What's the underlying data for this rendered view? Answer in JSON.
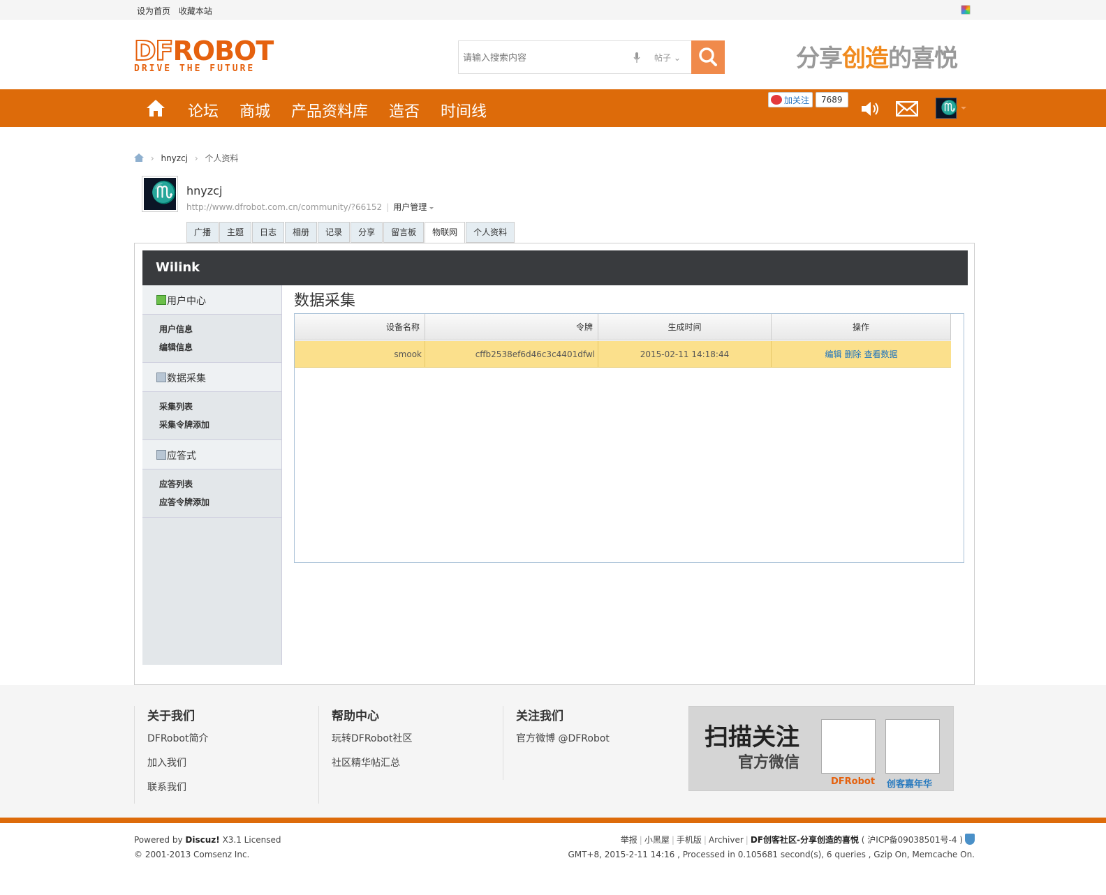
{
  "topbar": {
    "set_home": "设为首页",
    "bookmark": "收藏本站"
  },
  "header": {
    "logo_main_df": "DF",
    "logo_main_robot": "ROBOT",
    "logo_sub": "DRIVE THE FUTURE",
    "search_placeholder": "请输入搜索内容",
    "search_type": "帖子",
    "slogan_a": "分享",
    "slogan_b": "创造",
    "slogan_c": "的喜悦"
  },
  "nav": {
    "items": [
      "论坛",
      "商城",
      "产品资料库",
      "造否",
      "时间线"
    ],
    "weibo_follow": "加关注",
    "weibo_count": "7689"
  },
  "breadcrumb": {
    "user": "hnyzcj",
    "page": "个人资料"
  },
  "profile": {
    "username": "hnyzcj",
    "url": "http://www.dfrobot.com.cn/community/?66152",
    "manage": "用户管理"
  },
  "tabs": [
    "广播",
    "主题",
    "日志",
    "相册",
    "记录",
    "分享",
    "留言板",
    "物联网",
    "个人资料"
  ],
  "active_tab": "物联网",
  "wilink": {
    "title": "Wilink",
    "sections": [
      {
        "title": "用户中心",
        "items": [
          "用户信息",
          "编辑信息"
        ]
      },
      {
        "title": "数据采集",
        "items": [
          "采集列表",
          "采集令牌添加"
        ]
      },
      {
        "title": "应答式",
        "items": [
          "应答列表",
          "应答令牌添加"
        ]
      }
    ],
    "page_title": "数据采集",
    "table": {
      "headers": [
        "设备名称",
        "令牌",
        "生成时间",
        "操作"
      ],
      "rows": [
        {
          "name": "smook",
          "token": "cffb2538ef6d46c3c4401dfwl",
          "time": "2015-02-11 14:18:44",
          "actions": [
            "编辑",
            "删除",
            "查看数据"
          ]
        }
      ]
    }
  },
  "footer": {
    "about": {
      "title": "关于我们",
      "links": [
        "DFRobot简介",
        "加入我们",
        "联系我们"
      ]
    },
    "help": {
      "title": "帮助中心",
      "links": [
        "玩转DFRobot社区",
        "社区精华帖汇总"
      ]
    },
    "follow": {
      "title": "关注我们",
      "links": [
        "官方微博 @DFRobot"
      ]
    },
    "qr": {
      "line1": "扫描关注",
      "line2": "官方微信",
      "label1": "DFRobot",
      "label2": "创客嘉年华"
    },
    "powered_by": "Powered by",
    "discuz": "Discuz!",
    "version": "X3.1 Licensed",
    "copyright": "© 2001-2013 Comsenz Inc.",
    "links": [
      "举报",
      "小黑屋",
      "手机版",
      "Archiver"
    ],
    "site": "DF创客社区-分享创造的喜悦",
    "icp": "( 沪ICP备09038501号-4 )",
    "stats": "GMT+8, 2015-2-11 14:16 , Processed in 0.105681 second(s), 6 queries , Gzip On, Memcache On."
  }
}
